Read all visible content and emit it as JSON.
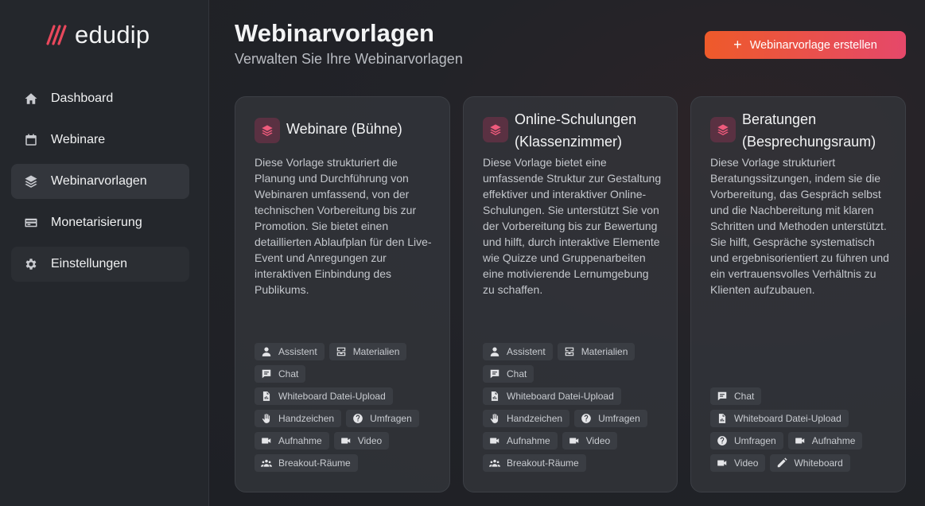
{
  "brand": {
    "name": "edudip"
  },
  "sidebar": {
    "items": [
      {
        "label": "Dashboard",
        "icon": "home-icon"
      },
      {
        "label": "Webinare",
        "icon": "calendar-icon"
      },
      {
        "label": "Webinarvorlagen",
        "icon": "layers-icon",
        "active": true
      },
      {
        "label": "Monetarisierung",
        "icon": "credit-card-icon"
      },
      {
        "label": "Einstellungen",
        "icon": "gear-icon"
      }
    ]
  },
  "header": {
    "title": "Webinarvorlagen",
    "subtitle": "Verwalten Sie Ihre Webinarvorlagen",
    "create_label": "Webinarvorlage erstellen"
  },
  "cards": [
    {
      "title": "Webinare (Bühne)",
      "description": "Diese Vorlage strukturiert die Planung und Durchführung von Webinaren umfassend, von der technischen Vorbereitung bis zur Promotion. Sie bietet einen detaillierten Ablaufplan für den Live-Event und Anregungen zur interaktiven Einbindung des Publikums.",
      "tags": [
        "Assistent",
        "Materialien",
        "Chat",
        "Whiteboard Datei-Upload",
        "Handzeichen",
        "Umfragen",
        "Aufnahme",
        "Video",
        "Breakout-Räume"
      ]
    },
    {
      "title": "Online-Schulungen (Klassenzimmer)",
      "description": "Diese Vorlage bietet eine umfassende Struktur zur Gestaltung effektiver und interaktiver Online-Schulungen. Sie unterstützt Sie von der Vorbereitung bis zur Bewertung und hilft, durch interaktive Elemente wie Quizze und Gruppenarbeiten eine motivierende Lernumgebung zu schaffen.",
      "tags": [
        "Assistent",
        "Materialien",
        "Chat",
        "Whiteboard Datei-Upload",
        "Handzeichen",
        "Umfragen",
        "Aufnahme",
        "Video",
        "Breakout-Räume"
      ]
    },
    {
      "title": "Beratungen (Besprechungsraum)",
      "description": "Diese Vorlage strukturiert Beratungssitzungen, indem sie die Vorbereitung, das Gespräch selbst und die Nachbereitung mit klaren Schritten und Methoden unterstützt. Sie hilft, Gespräche systematisch und ergebnisorientiert zu führen und ein vertrauensvolles Verhältnis zu Klienten aufzubauen.",
      "tags": [
        "Chat",
        "Whiteboard Datei-Upload",
        "Umfragen",
        "Aufnahme",
        "Video",
        "Whiteboard"
      ]
    }
  ],
  "colors": {
    "accent_start": "#ee5a2a",
    "accent_end": "#e5486a",
    "icon_bg": "#5a3142",
    "icon_fg": "#ef5b7c"
  }
}
